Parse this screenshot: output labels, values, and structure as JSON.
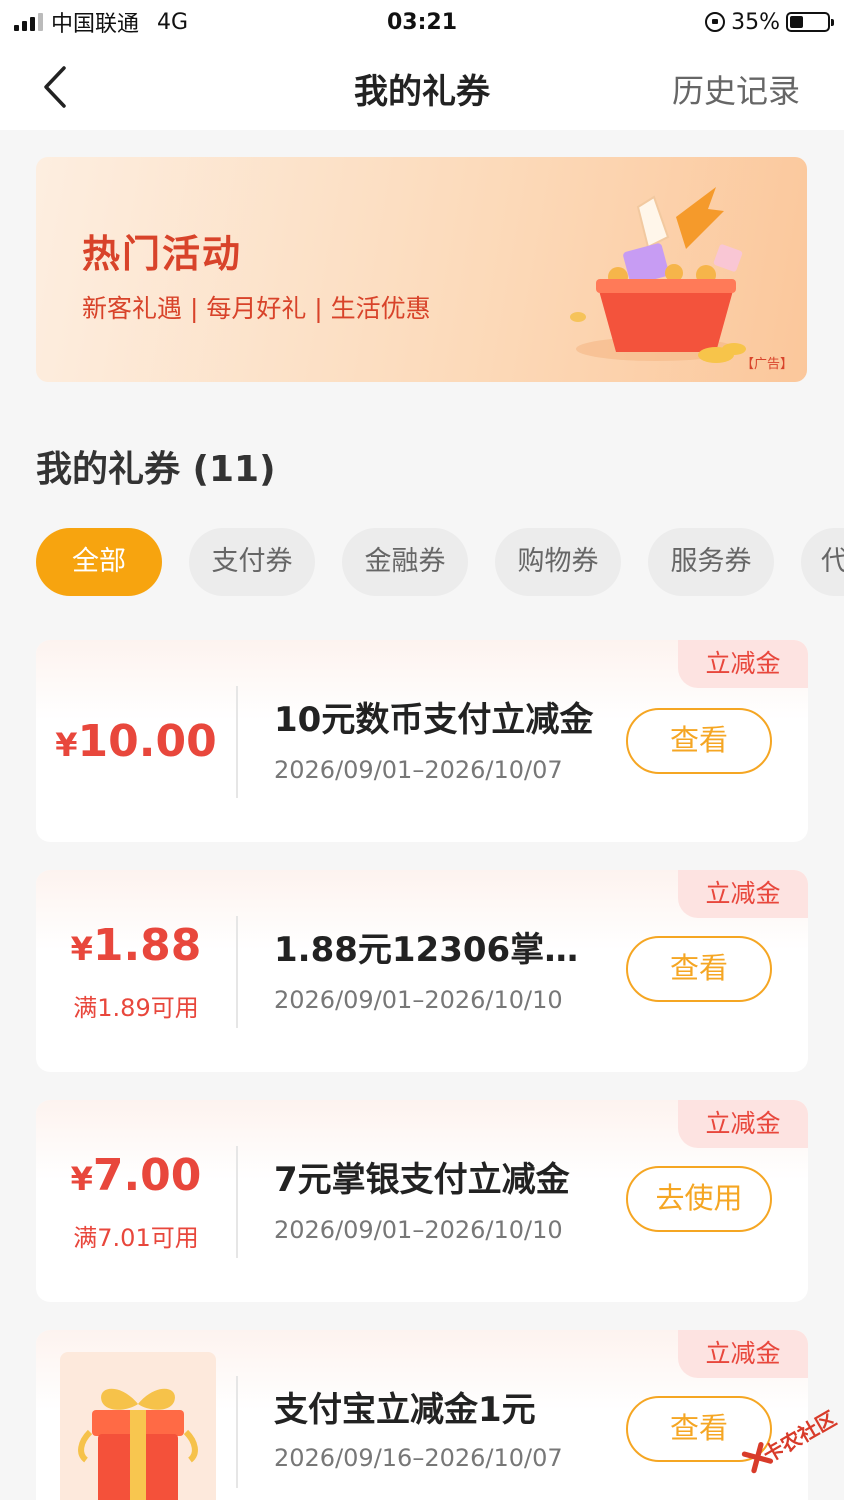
{
  "status_bar": {
    "carrier": "中国联通",
    "network": "4G",
    "time": "03:21",
    "battery": "35%",
    "battery_level": 0.35
  },
  "nav": {
    "title": "我的礼券",
    "history": "历史记录"
  },
  "banner": {
    "title": "热门活动",
    "subtitle": "新客礼遇 | 每月好礼 | 生活优惠",
    "ad_label": "【广告】"
  },
  "section": {
    "title": "我的礼券 (11)"
  },
  "tabs": [
    {
      "label": "全部",
      "active": true
    },
    {
      "label": "支付券",
      "active": false
    },
    {
      "label": "金融券",
      "active": false
    },
    {
      "label": "购物券",
      "active": false
    },
    {
      "label": "服务券",
      "active": false
    },
    {
      "label": "代",
      "active": false
    }
  ],
  "coupons": [
    {
      "tag": "立减金",
      "yen": "¥",
      "amount": "10.00",
      "condition": "",
      "name": "10元数币支付立减金",
      "date": "2026/09/01–2026/10/07",
      "button": "查看"
    },
    {
      "tag": "立减金",
      "yen": "¥",
      "amount": "1.88",
      "condition": "满1.89可用",
      "name": "1.88元12306掌银...",
      "date": "2026/09/01–2026/10/10",
      "button": "查看"
    },
    {
      "tag": "立减金",
      "yen": "¥",
      "amount": "7.00",
      "condition": "满7.01可用",
      "name": "7元掌银支付立减金",
      "date": "2026/09/01–2026/10/10",
      "button": "去使用"
    },
    {
      "tag": "立减金",
      "yen": "",
      "amount": "",
      "condition": "",
      "name": "支付宝立减金1元",
      "date": "2026/09/16–2026/10/07",
      "button": "查看"
    }
  ],
  "watermark": "卡农社区",
  "colors": {
    "accent": "#f7a40f",
    "red": "#e8473c",
    "button_border": "#f5a623"
  }
}
